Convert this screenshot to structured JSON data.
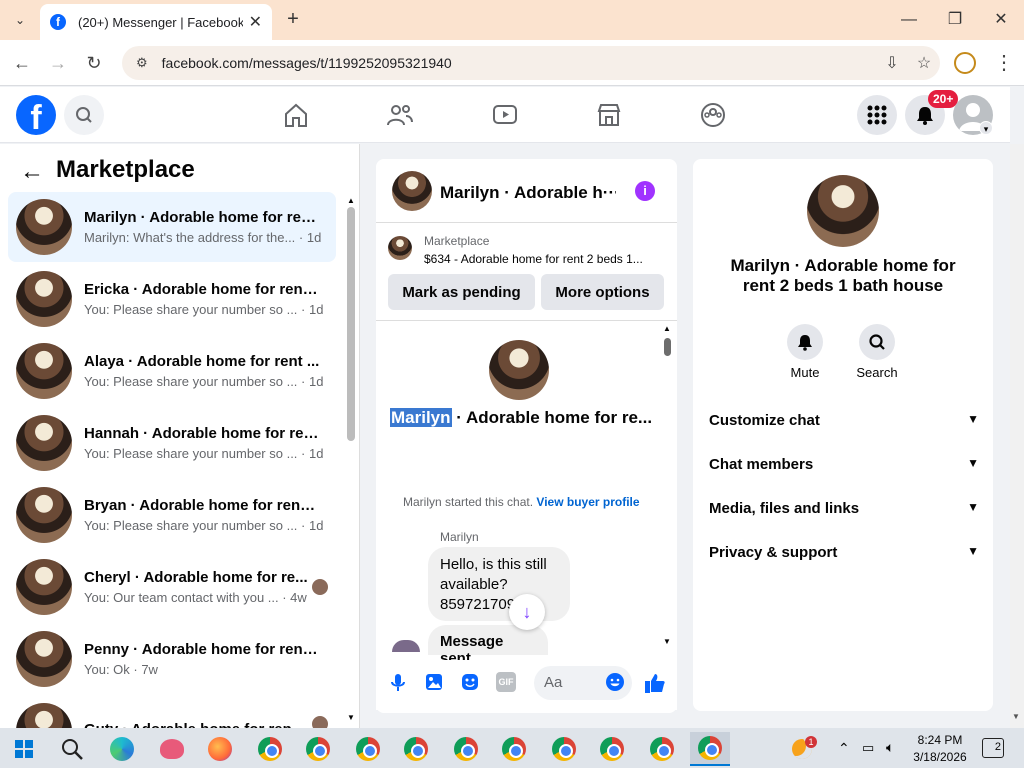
{
  "browser": {
    "tab_title": "(20+) Messenger | Facebook",
    "url": "facebook.com/messages/t/1199252095321940"
  },
  "fb": {
    "notif_badge": "20+",
    "logo": "f"
  },
  "left": {
    "title": "Marketplace",
    "conversations": [
      {
        "name": "Marilyn · Adorable home for ren...",
        "snippet": "Marilyn: What's the address for the... · 1d"
      },
      {
        "name": "Ericka · Adorable home for rent ...",
        "snippet": "You: Please share your number so ... · 1d"
      },
      {
        "name": "Alaya · Adorable home for rent ...",
        "snippet": "You: Please share your number so ... · 1d"
      },
      {
        "name": "Hannah · Adorable home for ren...",
        "snippet": "You: Please share your number so ... · 1d"
      },
      {
        "name": "Bryan · Adorable home for rent ...",
        "snippet": "You: Please share your number so ... · 1d"
      },
      {
        "name": "Cheryl · Adorable home for re...",
        "snippet": "You: Our team contact with you ... · 4w"
      },
      {
        "name": "Penny · Adorable home for rent ...",
        "snippet": "You: Ok · 7w"
      },
      {
        "name": "Guty · Adorable home for ren...",
        "snippet": ""
      }
    ]
  },
  "chat": {
    "title": "Marilyn · Adorable h···",
    "marketplace_label": "Marketplace",
    "listing": "$634 - Adorable home for rent 2 beds 1...",
    "mark_pending": "Mark as pending",
    "more_options": "More options",
    "highlight_name": "Marilyn",
    "header_rest": " · Adorable home for re...",
    "started_text": "Marilyn started this chat.",
    "view_buyer": "View buyer profile",
    "sender": "Marilyn",
    "message": "Hello, is this still available? 859721709",
    "message2": "Message sent",
    "composer_placeholder": "Aa"
  },
  "right": {
    "name": "Marilyn · Adorable home for rent 2 beds 1 bath house",
    "mute": "Mute",
    "search": "Search",
    "sections": [
      "Customize chat",
      "Chat members",
      "Media, files and links",
      "Privacy & support"
    ]
  },
  "taskbar": {
    "time": "8:24 PM",
    "date": "3/18/2026",
    "notifications": "2",
    "badge": "1"
  }
}
